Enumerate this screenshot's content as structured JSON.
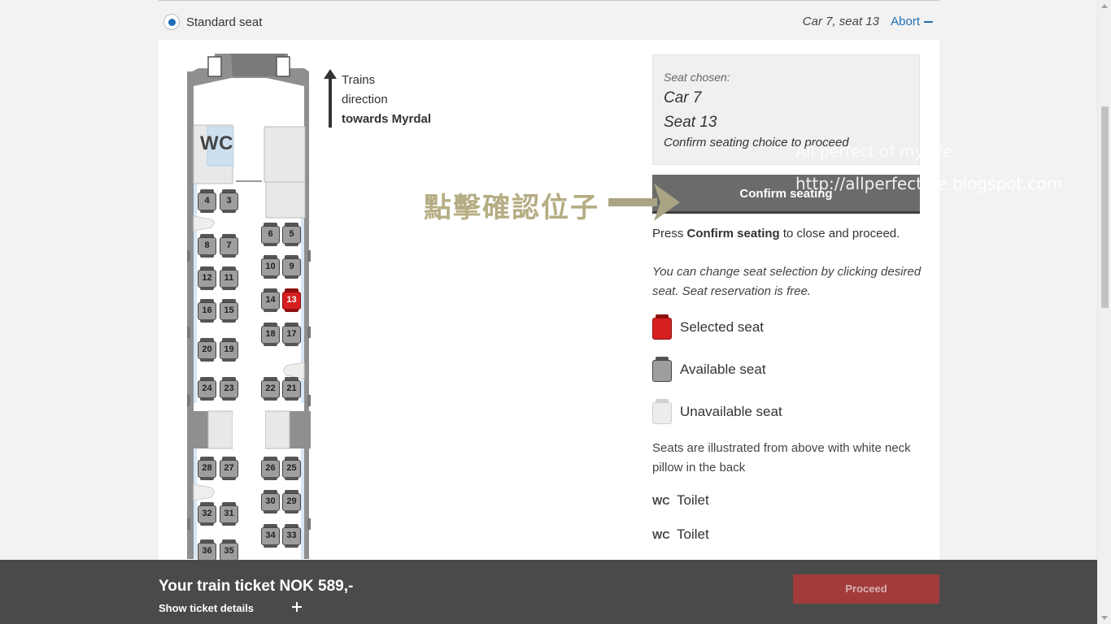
{
  "header": {
    "seat_type": "Standard seat",
    "seat_summary": "Car 7, seat 13",
    "abort_label": "Abort"
  },
  "train_map": {
    "wc_label": "WC",
    "selected_seat": "13",
    "seats": [
      "4",
      "3",
      "6",
      "5",
      "8",
      "7",
      "10",
      "9",
      "12",
      "11",
      "14",
      "13",
      "16",
      "15",
      "18",
      "17",
      "20",
      "19",
      "24",
      "23",
      "22",
      "21",
      "28",
      "27",
      "26",
      "25",
      "30",
      "29",
      "32",
      "31",
      "34",
      "33",
      "36",
      "35"
    ]
  },
  "direction": {
    "line1": "Trains",
    "line2": "direction",
    "line3": "towards Myrdal"
  },
  "chosen": {
    "label": "Seat chosen:",
    "car": "Car 7",
    "seat": "Seat 13",
    "note": "Confirm seating choice to proceed"
  },
  "confirm_button": "Confirm seating",
  "instruction": {
    "prefix": "Press ",
    "bold": "Confirm seating",
    "suffix": " to close and proceed."
  },
  "change_note": "You can change seat selection by clicking desired seat. Seat reservation is free.",
  "legend": {
    "selected": "Selected seat",
    "available": "Available seat",
    "unavailable": "Unavailable seat",
    "illustrated_note": "Seats are illustrated from above with white neck pillow in the back",
    "wc_symbol": "WC",
    "toilet": "Toilet"
  },
  "overlay": {
    "cjk_annotation": "點擊確認位子",
    "watermark_title": "All perfect of my life",
    "watermark_url": "http://allperfectlife.blogspot.com"
  },
  "footer": {
    "price": "Your train ticket NOK 589,-",
    "details_label": "Show ticket details",
    "proceed_label": "Proceed"
  },
  "colors": {
    "accent": "#1f6fb5",
    "selected_seat": "#d61f1f",
    "available_seat": "#9e9e9e",
    "unavailable_seat": "#e6e6e6",
    "proceed_button": "#a23c3c"
  }
}
